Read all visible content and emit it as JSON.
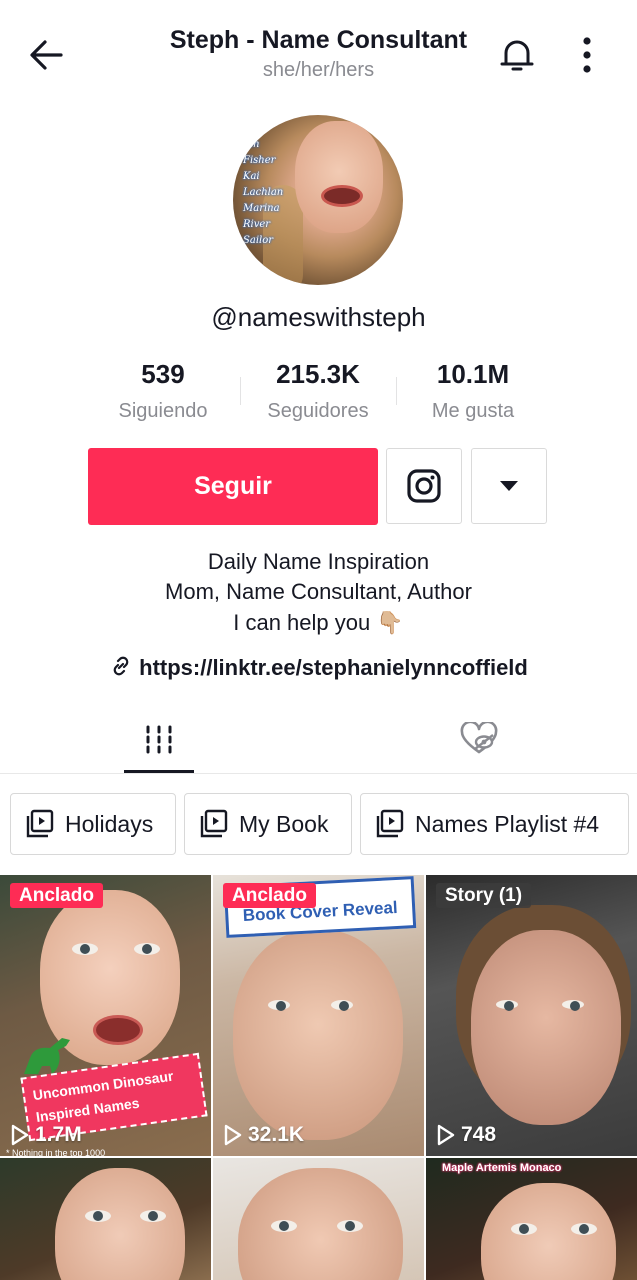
{
  "header": {
    "title": "Steph - Name Consultant",
    "pronouns": "she/her/hers"
  },
  "profile": {
    "handle": "@nameswithsteph",
    "avatar_names": [
      "Jan",
      "Fisher",
      "Kai",
      "Lachlan",
      "Marina",
      "River",
      "Sailor"
    ]
  },
  "stats": [
    {
      "value": "539",
      "label": "Siguiendo"
    },
    {
      "value": "215.3K",
      "label": "Seguidores"
    },
    {
      "value": "10.1M",
      "label": "Me gusta"
    }
  ],
  "actions": {
    "follow_label": "Seguir"
  },
  "bio": {
    "line1": "Daily Name Inspiration",
    "line2": "Mom, Name Consultant, Author",
    "line3": "I can help you 👇🏼",
    "link": "https://linktr.ee/stephanielynncoffield"
  },
  "playlists": [
    "Holidays",
    "My Book",
    "Names Playlist #4"
  ],
  "videos": [
    {
      "badge": "Anclado",
      "views": "1.7M",
      "overlay": "Uncommon Dinosaur Inspired Names",
      "caption": "* Nothing in the top 1000"
    },
    {
      "badge": "Anclado",
      "views": "32.1K",
      "overlay": "Book Cover Reveal"
    },
    {
      "badge": "Story (1)",
      "views": "748"
    },
    {
      "overlay": ""
    },
    {
      "overlay": ""
    },
    {
      "overlay": "Maple Artemis Monaco"
    }
  ],
  "colors": {
    "accent": "#fe2c55",
    "text": "#161823",
    "muted": "#8a8b91"
  }
}
